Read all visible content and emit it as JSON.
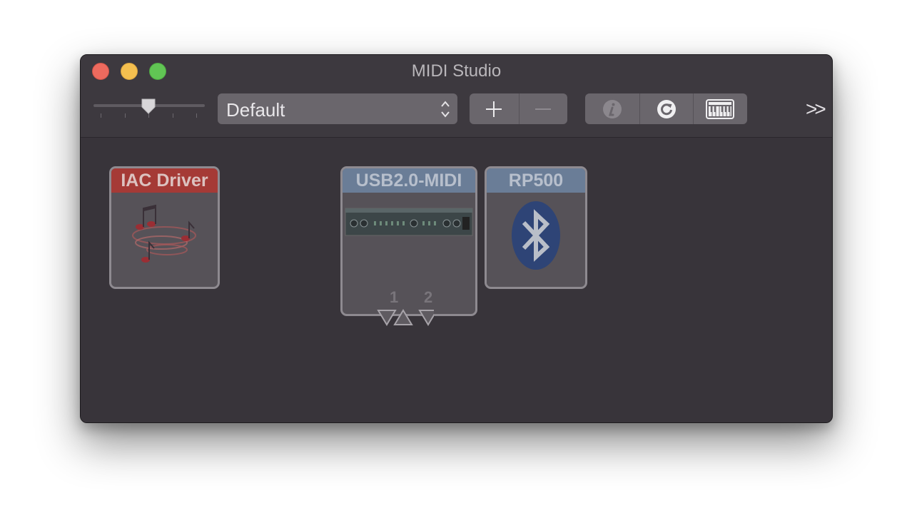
{
  "window": {
    "title": "MIDI Studio"
  },
  "toolbar": {
    "configuration": "Default",
    "add_label": "+",
    "remove_label": "−",
    "overflow_label": ">>"
  },
  "devices": [
    {
      "name": "IAC Driver",
      "icon": "music-notes-icon"
    },
    {
      "name": "USB2.0-MIDI",
      "icon": "midi-interface-icon",
      "ports": [
        "1",
        "2"
      ]
    },
    {
      "name": "RP500",
      "icon": "bluetooth-icon"
    }
  ],
  "colors": {
    "iac_header": "#a53a36",
    "device_header": "#6a7d97",
    "window_background": "#38343a"
  }
}
